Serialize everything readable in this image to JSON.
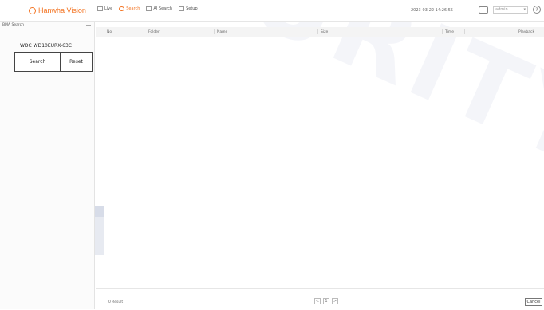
{
  "brand": {
    "name": "Hanwha Vision"
  },
  "nav": [
    {
      "label": "Live",
      "icon": "monitor-icon",
      "active": false
    },
    {
      "label": "Search",
      "icon": "search-icon",
      "active": true
    },
    {
      "label": "AI Search",
      "icon": "ai-search-icon",
      "active": false
    },
    {
      "label": "Setup",
      "icon": "setup-icon",
      "active": false
    }
  ],
  "topbar": {
    "datetime": "2023-03-22 14:26:55",
    "user_select": "admin",
    "help": "?"
  },
  "sidebar": {
    "title": "BMA Search",
    "device": "WDC WD10EURX-63C",
    "search_label": "Search",
    "reset_label": "Reset"
  },
  "table": {
    "columns": [
      "No.",
      "Folder",
      "Name",
      "Size",
      "Time",
      "Playback"
    ]
  },
  "footer": {
    "left_text": "0 Result",
    "page": "1",
    "prev": "<",
    "next": ">",
    "cancel_label": "Cancel"
  },
  "colors": {
    "accent": "#f37321",
    "border": "#e3e3e3"
  }
}
